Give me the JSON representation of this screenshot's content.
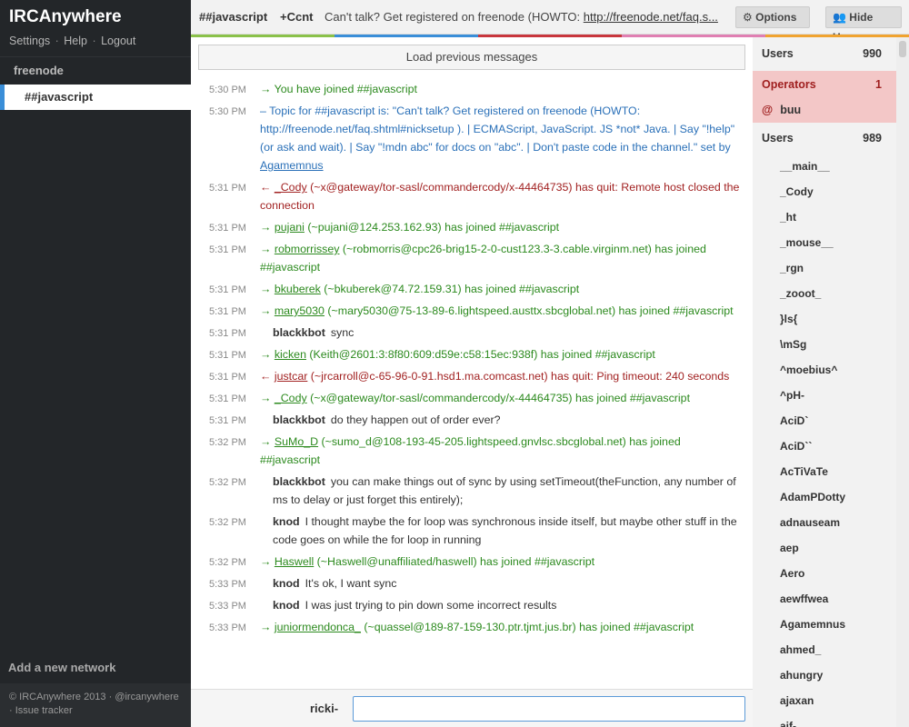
{
  "app": {
    "brand": "IRCAnywhere",
    "links": [
      "Settings",
      "Help",
      "Logout"
    ],
    "network": "freenode",
    "active_channel": "##javascript",
    "add_network": "Add a new network",
    "footer": "© IRCAnywhere 2013 · @ircanywhere · Issue tracker"
  },
  "header": {
    "channel": "##javascript",
    "modes": "+Ccnt",
    "topic_text": "Can't talk? Get registered on freenode (HOWTO: ",
    "topic_link": "http://freenode.net/faq.s...",
    "options_label": "Options",
    "hide_users_label": "Hide Users"
  },
  "colorbar": [
    "#8ac149",
    "#8ac149",
    "#3a8ed8",
    "#3a8ed8",
    "#c8363c",
    "#c8363c",
    "#e07fb2",
    "#e07fb2",
    "#f0a330",
    "#f0a330"
  ],
  "load_previous": "Load previous messages",
  "messages": [
    {
      "time": "5:30 PM",
      "type": "join",
      "text": "→ You have joined ##javascript"
    },
    {
      "time": "5:30 PM",
      "type": "topic",
      "text": "– Topic for ##javascript is: \"Can't talk? Get registered on freenode (HOWTO: http://freenode.net/faq.shtml#nicksetup ). | ECMAScript, JavaScript. JS *not* Java. | Say \"!help\" (or ask and wait). | Say \"!mdn abc\" for docs on \"abc\". | Don't paste code in the channel.\" set by ",
      "link": "Agamemnus"
    },
    {
      "time": "5:31 PM",
      "type": "quit",
      "prefix": "← ",
      "link": "_Cody",
      "text": " (~x@gateway/tor-sasl/commandercody/x-44464735) has quit: Remote host closed the connection"
    },
    {
      "time": "5:31 PM",
      "type": "join",
      "prefix": "→ ",
      "link": "pujani",
      "text": " (~pujani@124.253.162.93) has joined ##javascript"
    },
    {
      "time": "5:31 PM",
      "type": "join",
      "prefix": "→ ",
      "link": "robmorrissey",
      "text": " (~robmorris@cpc26-brig15-2-0-cust123.3-3.cable.virginm.net) has joined ##javascript"
    },
    {
      "time": "5:31 PM",
      "type": "join",
      "prefix": "→ ",
      "link": "bkuberek",
      "text": " (~bkuberek@74.72.159.31) has joined ##javascript"
    },
    {
      "time": "5:31 PM",
      "type": "join",
      "prefix": "→ ",
      "link": "mary5030",
      "text": " (~mary5030@75-13-89-6.lightspeed.austtx.sbcglobal.net) has joined ##javascript"
    },
    {
      "time": "5:31 PM",
      "type": "msg",
      "nick": "blackkbot",
      "text": "sync"
    },
    {
      "time": "5:31 PM",
      "type": "join",
      "prefix": "→ ",
      "link": "kicken",
      "text": " (Keith@2601:3:8f80:609:d59e:c58:15ec:938f) has joined ##javascript"
    },
    {
      "time": "5:31 PM",
      "type": "quit",
      "prefix": "← ",
      "link": "justcar",
      "text": " (~jrcarroll@c-65-96-0-91.hsd1.ma.comcast.net) has quit: Ping timeout: 240 seconds"
    },
    {
      "time": "5:31 PM",
      "type": "join",
      "prefix": "→ ",
      "link": "_Cody",
      "text": " (~x@gateway/tor-sasl/commandercody/x-44464735) has joined ##javascript"
    },
    {
      "time": "5:31 PM",
      "type": "msg",
      "nick": "blackkbot",
      "text": "do they happen out of order ever?"
    },
    {
      "time": "5:32 PM",
      "type": "join",
      "prefix": "→ ",
      "link": "SuMo_D",
      "text": " (~sumo_d@108-193-45-205.lightspeed.gnvlsc.sbcglobal.net) has joined ##javascript"
    },
    {
      "time": "5:32 PM",
      "type": "msg",
      "nick": "blackkbot",
      "text": "you can make things out of sync by using setTimeout(theFunction, any number of ms to delay or just forget this entirely);"
    },
    {
      "time": "5:32 PM",
      "type": "msg",
      "nick": "knod",
      "text": "I thought maybe the for loop was synchronous inside itself, but maybe other stuff in the code goes on while the for loop in running"
    },
    {
      "time": "5:32 PM",
      "type": "join",
      "prefix": "→ ",
      "link": "Haswell",
      "text": " (~Haswell@unaffiliated/haswell) has joined ##javascript"
    },
    {
      "time": "5:33 PM",
      "type": "msg",
      "nick": "knod",
      "text": "It's ok, I want sync"
    },
    {
      "time": "5:33 PM",
      "type": "msg",
      "nick": "knod",
      "text": "I was just trying to pin down some incorrect results"
    },
    {
      "time": "5:33 PM",
      "type": "join",
      "prefix": "→ ",
      "link": "juniormendonca_",
      "text": " (~quassel@189-87-159-130.ptr.tjmt.jus.br) has joined ##javascript"
    }
  ],
  "input": {
    "nick": "ricki-",
    "value": "",
    "placeholder": ""
  },
  "userlist": {
    "users_label": "Users",
    "users_count": "990",
    "operators_label": "Operators",
    "operators_count": "1",
    "operator_prefix": "@",
    "operator_nick": "buu",
    "regular_label": "Users",
    "regular_count": "989",
    "users": [
      "__main__",
      "_Cody",
      "_ht",
      "_mouse__",
      "_rgn",
      "_zooot_",
      "}ls{",
      "\\mSg",
      "^moebius^",
      "^pH-",
      "AciD`",
      "AciD``",
      "AcTiVaTe",
      "AdamPDotty",
      "adnauseam",
      "aep",
      "Aero",
      "aewffwea",
      "Agamemnus",
      "ahmed_",
      "ahungry",
      "ajaxan",
      "aif-"
    ]
  }
}
